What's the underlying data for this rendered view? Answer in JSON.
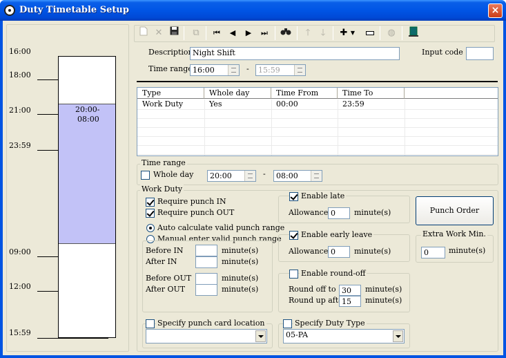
{
  "window": {
    "title": "Duty Timetable Setup",
    "close_glyph": "×"
  },
  "timeline": {
    "ticks": [
      "16:00",
      "18:00",
      "21:00",
      "23:59",
      "09:00",
      "12:00",
      "15:59"
    ],
    "block_line1": "20:00-",
    "block_line2": "08:00",
    "block_color": "#c2c2f7"
  },
  "toolbar": {
    "items": [
      "new-icon",
      "delete-icon",
      "save-icon",
      "copy-icon",
      "first-icon",
      "prev-icon",
      "next-icon",
      "last-icon",
      "find-icon",
      "move-up-icon",
      "move-down-icon",
      "add-icon",
      "remove-icon",
      "disabled-icon",
      "exit-icon"
    ]
  },
  "header": {
    "description_label": "Description",
    "description_value": "Night Shift",
    "input_code_label": "Input code :",
    "input_code_value": "",
    "time_range_label": "Time range",
    "time_from": "16:00",
    "time_to": "15:59",
    "dash": "-"
  },
  "table": {
    "columns": [
      "Type",
      "Whole day",
      "Time From",
      "Time To"
    ],
    "rows": [
      {
        "type": "Work Duty",
        "whole_day": "Yes",
        "time_from": "00:00",
        "time_to": "23:59"
      }
    ]
  },
  "time_range_group": {
    "label": "Time range",
    "whole_day_label": "Whole day",
    "from": "20:00",
    "to": "08:00",
    "dash": "-"
  },
  "work_duty": {
    "label": "Work Duty",
    "require_in": "Require punch IN",
    "require_out": "Require punch OUT",
    "auto_calc": "Auto calculate valid punch range",
    "manual_enter": "Manual enter valid punch range",
    "before_in": "Before IN",
    "after_in": "After IN",
    "before_out": "Before OUT",
    "after_out": "After OUT",
    "minutes": "minute(s)",
    "enable_late": "Enable late",
    "late_allowance_label": "Allowance",
    "late_allowance": "0",
    "enable_early": "Enable early leave",
    "early_allowance_label": "Allowance",
    "early_allowance": "0",
    "enable_roundoff": "Enable round-off",
    "round_off_label": "Round off to",
    "round_off_value": "30",
    "round_up_label": "Round up after",
    "round_up_value": "15",
    "punch_order_button": "Punch Order",
    "extra_work_label": "Extra Work Min.",
    "extra_work_value": "0",
    "specify_location": "Specify punch card location",
    "location_value": "",
    "specify_duty_type": "Specify Duty Type",
    "duty_type_value": "05-PA"
  }
}
